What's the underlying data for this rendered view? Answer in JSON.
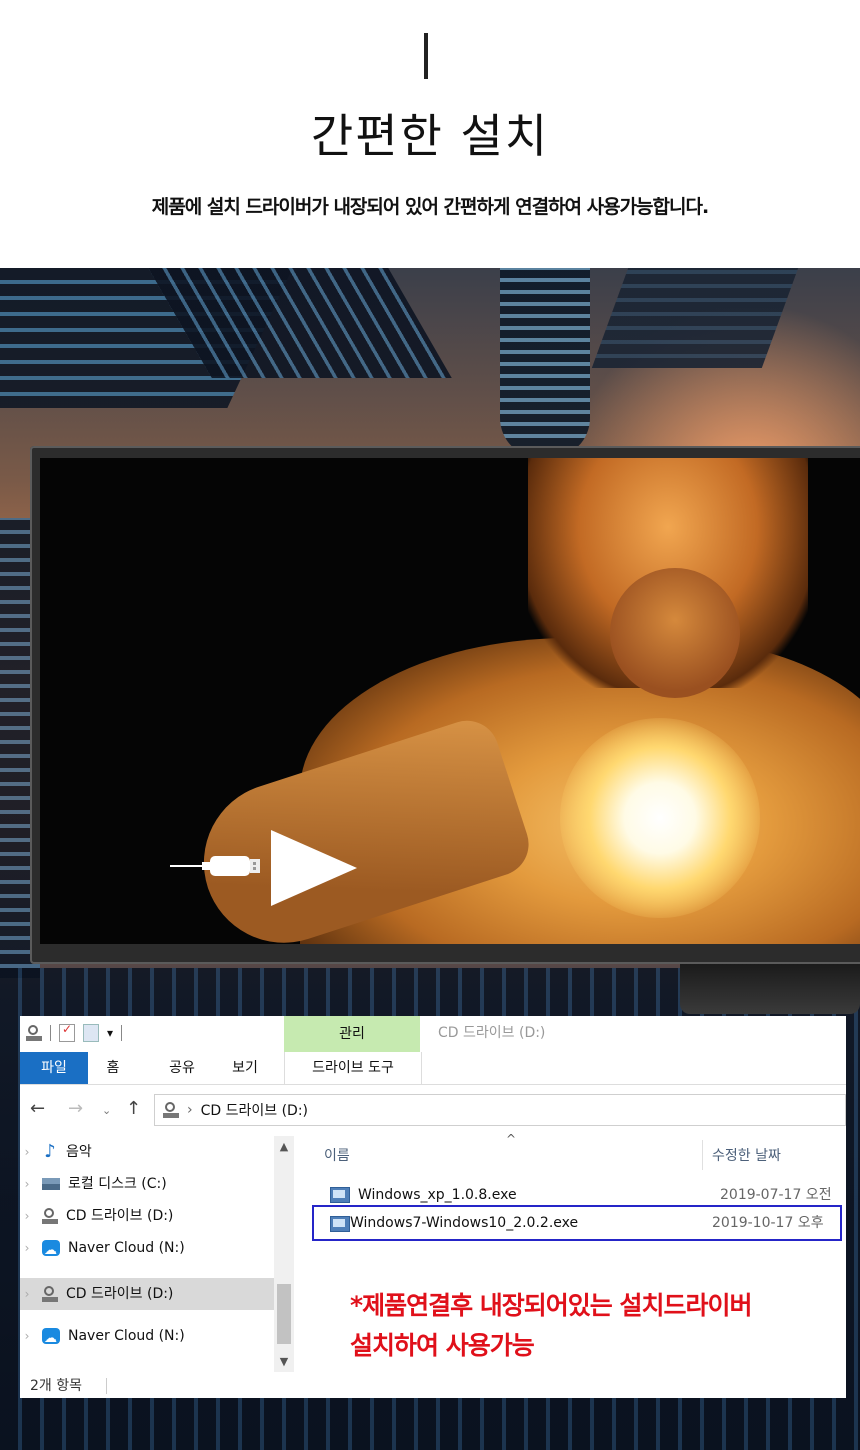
{
  "header": {
    "title": "간편한 설치",
    "subtitle": "제품에 설치 드라이버가 내장되어 있어 간편하게 연결하여 사용가능합니다."
  },
  "explorer": {
    "context_tab": "관리",
    "window_title": "CD 드라이브 (D:)",
    "tabs": {
      "file": "파일",
      "home": "홈",
      "share": "공유",
      "view": "보기",
      "drive_tools": "드라이브 도구"
    },
    "address": "CD 드라이브 (D:)",
    "nav_items": [
      {
        "label": "음악",
        "icon": "music-icon"
      },
      {
        "label": "로컬 디스크 (C:)",
        "icon": "hdd-icon"
      },
      {
        "label": "CD 드라이브 (D:)",
        "icon": "cd-drive-icon"
      },
      {
        "label": "Naver Cloud (N:)",
        "icon": "cloud-icon"
      },
      {
        "label": "CD 드라이브 (D:)",
        "icon": "cd-drive-icon",
        "selected": true
      },
      {
        "label": "Naver Cloud (N:)",
        "icon": "cloud-icon"
      }
    ],
    "columns": {
      "name": "이름",
      "modified": "수정한 날짜"
    },
    "files": [
      {
        "name": "Windows_xp_1.0.8.exe",
        "date": "2019-07-17 오전"
      },
      {
        "name": "Windows7-Windows10_2.0.2.exe",
        "date": "2019-10-17 오후",
        "highlighted": true
      }
    ],
    "status": "2개 항목",
    "note_line1": "*제품연결후 내장되어있는 설치드라이버",
    "note_line2": "설치하여 사용가능"
  },
  "colors": {
    "accent": "#1a6fc4",
    "context_tab": "#c6eab0",
    "note": "#e0101a",
    "highlight_border": "#2525c8"
  }
}
